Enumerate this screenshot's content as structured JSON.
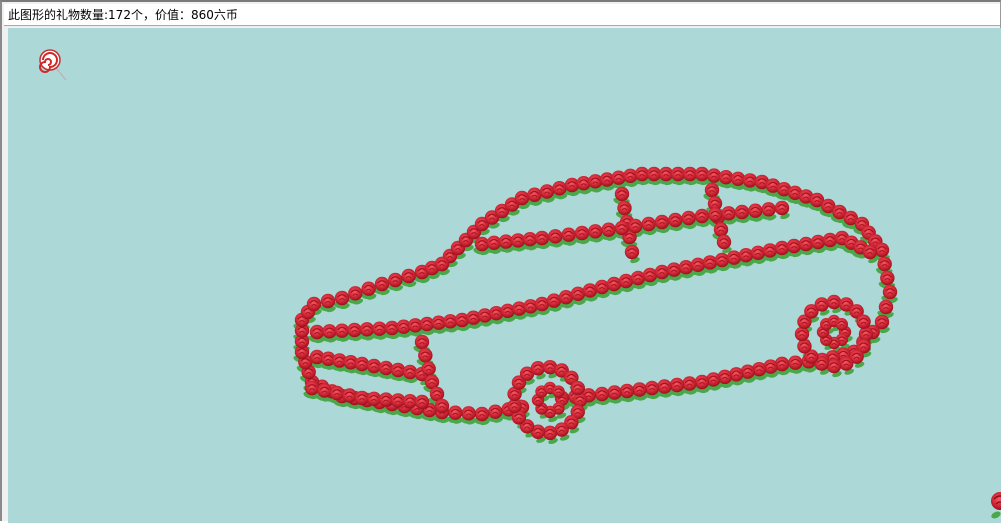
{
  "window": {
    "info_text": "此图形的礼物数量:172个，价值：860六币"
  },
  "canvas": {
    "background_color": "#add8d8",
    "rose_color": "#d42c3a",
    "rose_dark": "#a8101e",
    "leaf_color": "#4aa84a",
    "shape": "car",
    "gift_count": 172
  },
  "icons": {
    "cursor_tool": "lollipop-icon",
    "corner_rose": "rose-icon"
  }
}
